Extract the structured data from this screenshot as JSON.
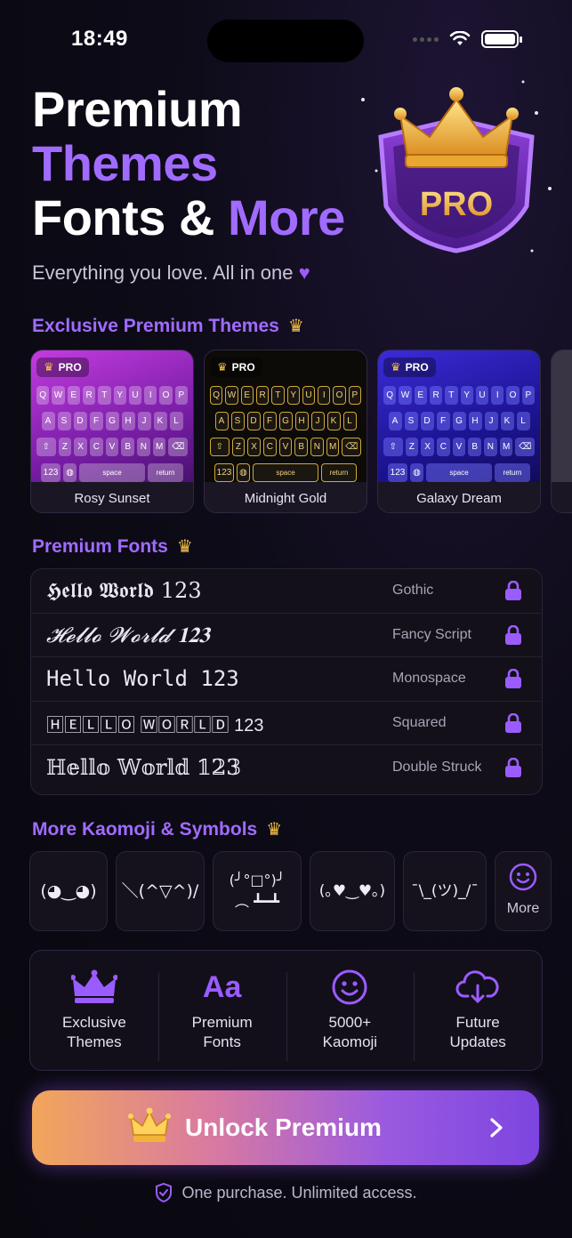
{
  "status_bar": {
    "time": "18:49"
  },
  "hero": {
    "line1": "Premium",
    "line2": "Themes",
    "line3_white": "Fonts &",
    "line3_purple": "More",
    "tagline": "Everything you love. All in one",
    "badge_text": "PRO"
  },
  "sections": {
    "themes_title": "Exclusive Premium Themes",
    "fonts_title": "Premium Fonts",
    "kaomoji_title": "More Kaomoji & Symbols"
  },
  "themes": [
    {
      "name": "Rosy Sunset",
      "tag": "PRO"
    },
    {
      "name": "Midnight Gold",
      "tag": "PRO"
    },
    {
      "name": "Galaxy Dream",
      "tag": "PRO"
    }
  ],
  "keyboard": {
    "row1": [
      "Q",
      "W",
      "E",
      "R",
      "T",
      "Y",
      "U",
      "I",
      "O",
      "P"
    ],
    "row2": [
      "A",
      "S",
      "D",
      "F",
      "G",
      "H",
      "J",
      "K",
      "L"
    ],
    "row3": [
      "Z",
      "X",
      "C",
      "V",
      "B",
      "N",
      "M"
    ],
    "num": "123",
    "space": "space",
    "return": "return"
  },
  "fonts": [
    {
      "sample": "𝕳𝖊𝖑𝖑𝖔 𝖂𝖔𝖗𝖑𝖉 123",
      "name": "Gothic"
    },
    {
      "sample": "𝓗𝓮𝓵𝓵𝓸 𝓦𝓸𝓻𝓵𝓭 𝟏𝟐𝟑",
      "name": "Fancy Script"
    },
    {
      "sample": "Hello World 123",
      "name": "Monospace"
    },
    {
      "sample": "🄷🄴🄻🄻🄾 🅆🄾🅁🄻🄳 123",
      "name": "Squared"
    },
    {
      "sample": "ℍ𝕖𝕝𝕝𝕠 𝕎𝕠𝕣𝕝𝕕 𝟙𝟚𝟛",
      "name": "Double Struck"
    }
  ],
  "kaomoji": [
    "(◕‿◕)",
    "＼(^▽^)/",
    "(╯°□°)╯\n︵ ┻━┻",
    "(｡♥‿♥｡)",
    "¯\\_(ツ)_/¯"
  ],
  "kaomoji_more": "More",
  "features": [
    {
      "label": "Exclusive\nThemes",
      "icon": "crown-icon"
    },
    {
      "label": "Premium\nFonts",
      "icon": "aa-icon",
      "icon_text": "Aa"
    },
    {
      "label": "5000+\nKaomoji",
      "icon": "smiley-icon"
    },
    {
      "label": "Future\nUpdates",
      "icon": "cloud-download-icon"
    }
  ],
  "cta": {
    "label": "Unlock Premium"
  },
  "footer": {
    "text": "One purchase. Unlimited access."
  },
  "colors": {
    "accent": "#a16bff",
    "gold": "#f5c04a",
    "background": "#0d0b17"
  }
}
